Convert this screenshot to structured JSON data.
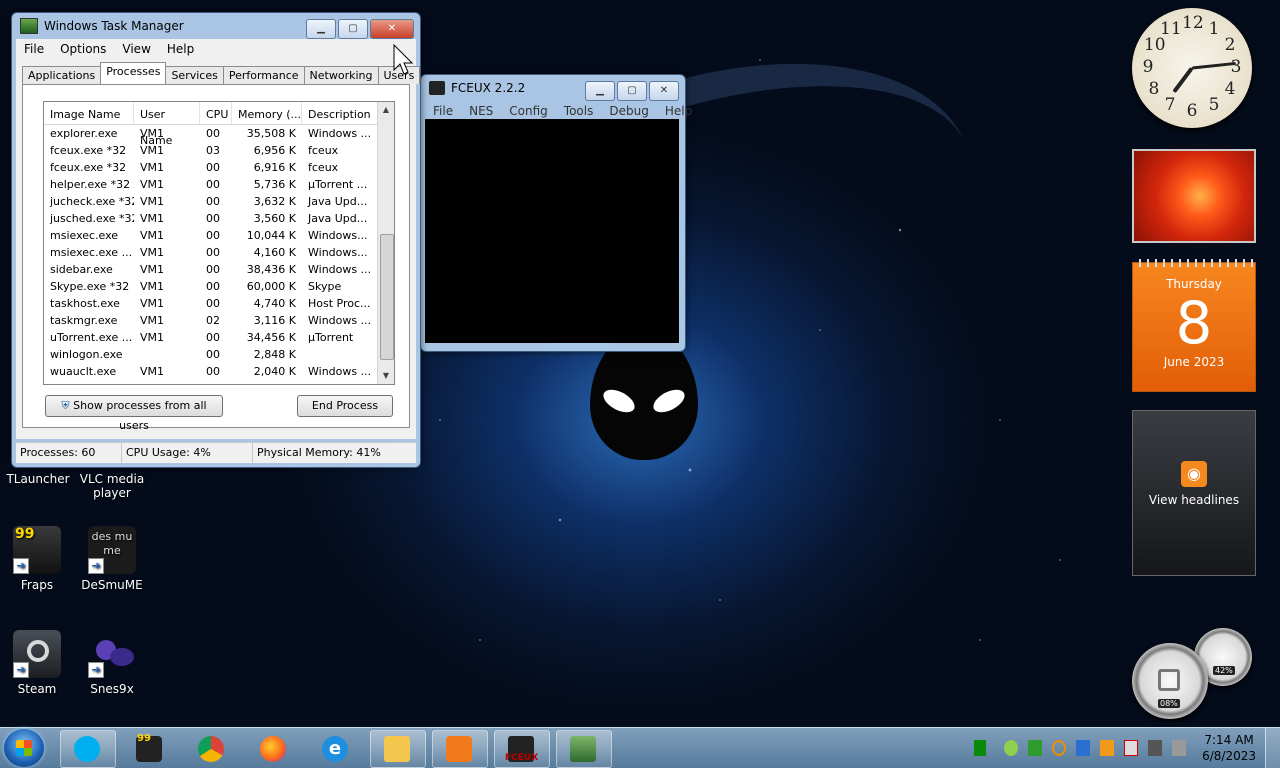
{
  "desktop": {
    "icons": [
      {
        "label": "TLauncher"
      },
      {
        "label": "VLC media player"
      },
      {
        "label": "Fraps",
        "badge": "99"
      },
      {
        "label": "DeSmuME",
        "art": "des mu me"
      },
      {
        "label": "Steam"
      },
      {
        "label": "Snes9x"
      }
    ]
  },
  "task_manager": {
    "title": "Windows Task Manager",
    "menu": [
      "File",
      "Options",
      "View",
      "Help"
    ],
    "tabs": [
      "Applications",
      "Processes",
      "Services",
      "Performance",
      "Networking",
      "Users"
    ],
    "active_tab": "Processes",
    "columns": [
      "Image Name",
      "User Name",
      "CPU",
      "Memory (...",
      "Description"
    ],
    "rows": [
      {
        "name": "explorer.exe",
        "user": "VM1",
        "cpu": "00",
        "mem": "35,508 K",
        "desc": "Windows ..."
      },
      {
        "name": "fceux.exe *32",
        "user": "VM1",
        "cpu": "03",
        "mem": "6,956 K",
        "desc": "fceux"
      },
      {
        "name": "fceux.exe *32",
        "user": "VM1",
        "cpu": "00",
        "mem": "6,916 K",
        "desc": "fceux"
      },
      {
        "name": "helper.exe *32",
        "user": "VM1",
        "cpu": "00",
        "mem": "5,736 K",
        "desc": "µTorrent ..."
      },
      {
        "name": "jucheck.exe *32",
        "user": "VM1",
        "cpu": "00",
        "mem": "3,632 K",
        "desc": "Java Upd..."
      },
      {
        "name": "jusched.exe *32",
        "user": "VM1",
        "cpu": "00",
        "mem": "3,560 K",
        "desc": "Java Upd..."
      },
      {
        "name": "msiexec.exe",
        "user": "VM1",
        "cpu": "00",
        "mem": "10,044 K",
        "desc": "Windows..."
      },
      {
        "name": "msiexec.exe ...",
        "user": "VM1",
        "cpu": "00",
        "mem": "4,160 K",
        "desc": "Windows..."
      },
      {
        "name": "sidebar.exe",
        "user": "VM1",
        "cpu": "00",
        "mem": "38,436 K",
        "desc": "Windows ..."
      },
      {
        "name": "Skype.exe *32",
        "user": "VM1",
        "cpu": "00",
        "mem": "60,000 K",
        "desc": "Skype"
      },
      {
        "name": "taskhost.exe",
        "user": "VM1",
        "cpu": "00",
        "mem": "4,740 K",
        "desc": "Host Proc..."
      },
      {
        "name": "taskmgr.exe",
        "user": "VM1",
        "cpu": "02",
        "mem": "3,116 K",
        "desc": "Windows ..."
      },
      {
        "name": "uTorrent.exe ...",
        "user": "VM1",
        "cpu": "00",
        "mem": "34,456 K",
        "desc": "µTorrent"
      },
      {
        "name": "winlogon.exe",
        "user": "",
        "cpu": "00",
        "mem": "2,848 K",
        "desc": ""
      },
      {
        "name": "wuauclt.exe",
        "user": "VM1",
        "cpu": "00",
        "mem": "2,040 K",
        "desc": "Windows ..."
      }
    ],
    "show_all_label": "Show processes from all users",
    "end_process_label": "End Process",
    "status": {
      "processes": "Processes: 60",
      "cpu": "CPU Usage: 4%",
      "memory": "Physical Memory: 41%"
    }
  },
  "fceux": {
    "title": "FCEUX 2.2.2",
    "menu": [
      "File",
      "NES",
      "Config",
      "Tools",
      "Debug",
      "Help"
    ]
  },
  "gadgets": {
    "clock_numbers": [
      "12",
      "1",
      "2",
      "3",
      "4",
      "5",
      "6",
      "7",
      "8",
      "9",
      "10",
      "11"
    ],
    "calendar": {
      "weekday": "Thursday",
      "day": "8",
      "month_year": "June 2023"
    },
    "feed_label": "View headlines",
    "meter_cpu": "08%",
    "meter_mem": "42%"
  },
  "taskbar": {
    "apps": [
      "skype-icon",
      "fraps-icon",
      "chrome-icon",
      "firefox-icon",
      "ie-icon",
      "explorer-icon",
      "media-player-icon",
      "fceux-icon",
      "task-manager-icon"
    ],
    "fraps_badge": "99",
    "fceux_badge": "FCEUX",
    "time": "7:14 AM",
    "date": "6/8/2023"
  },
  "colors": {
    "calendar": "#e8680c",
    "close_button": "#c7402a",
    "accent": "#1c5fb0"
  }
}
